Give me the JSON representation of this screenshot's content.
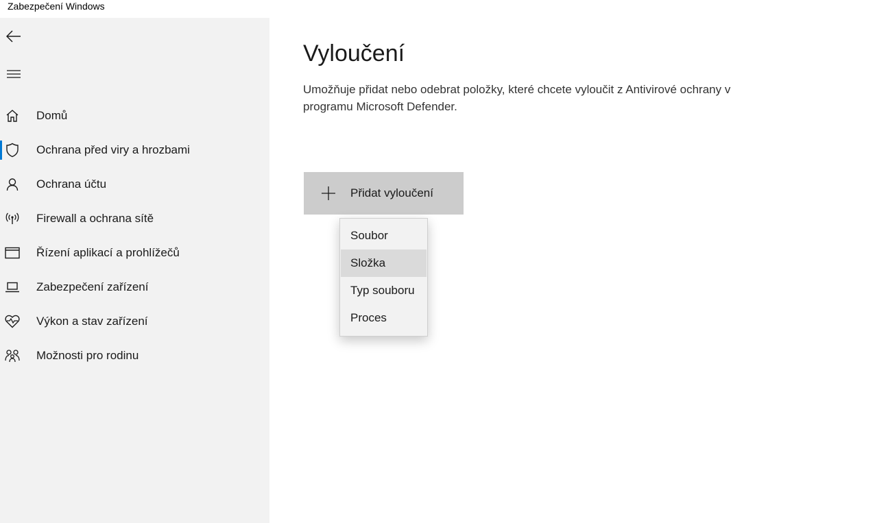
{
  "window": {
    "title": "Zabezpečení Windows"
  },
  "sidebar": {
    "back_icon": "back-arrow-icon",
    "menu_icon": "hamburger-icon",
    "accent_color": "#0078d4",
    "items": [
      {
        "label": "Domů",
        "icon": "home-icon",
        "active": false
      },
      {
        "label": "Ochrana před viry a hrozbami",
        "icon": "shield-icon",
        "active": true
      },
      {
        "label": "Ochrana účtu",
        "icon": "person-icon",
        "active": false
      },
      {
        "label": "Firewall a ochrana sítě",
        "icon": "wireless-icon",
        "active": false
      },
      {
        "label": "Řízení aplikací a prohlížečů",
        "icon": "app-window-icon",
        "active": false
      },
      {
        "label": "Zabezpečení zařízení",
        "icon": "laptop-icon",
        "active": false
      },
      {
        "label": "Výkon a stav zařízení",
        "icon": "heart-pulse-icon",
        "active": false
      },
      {
        "label": "Možnosti pro rodinu",
        "icon": "family-icon",
        "active": false
      }
    ]
  },
  "main": {
    "title": "Vyloučení",
    "description": "Umožňuje přidat nebo odebrat položky, které chcete vyloučit z Antivirové ochrany v programu Microsoft Defender.",
    "add_button": {
      "label": "Přidat vyloučení",
      "icon": "plus-icon"
    },
    "dropdown": {
      "items": [
        {
          "label": "Soubor",
          "highlighted": false
        },
        {
          "label": "Složka",
          "highlighted": true
        },
        {
          "label": "Typ souboru",
          "highlighted": false
        },
        {
          "label": "Proces",
          "highlighted": false
        }
      ]
    }
  }
}
